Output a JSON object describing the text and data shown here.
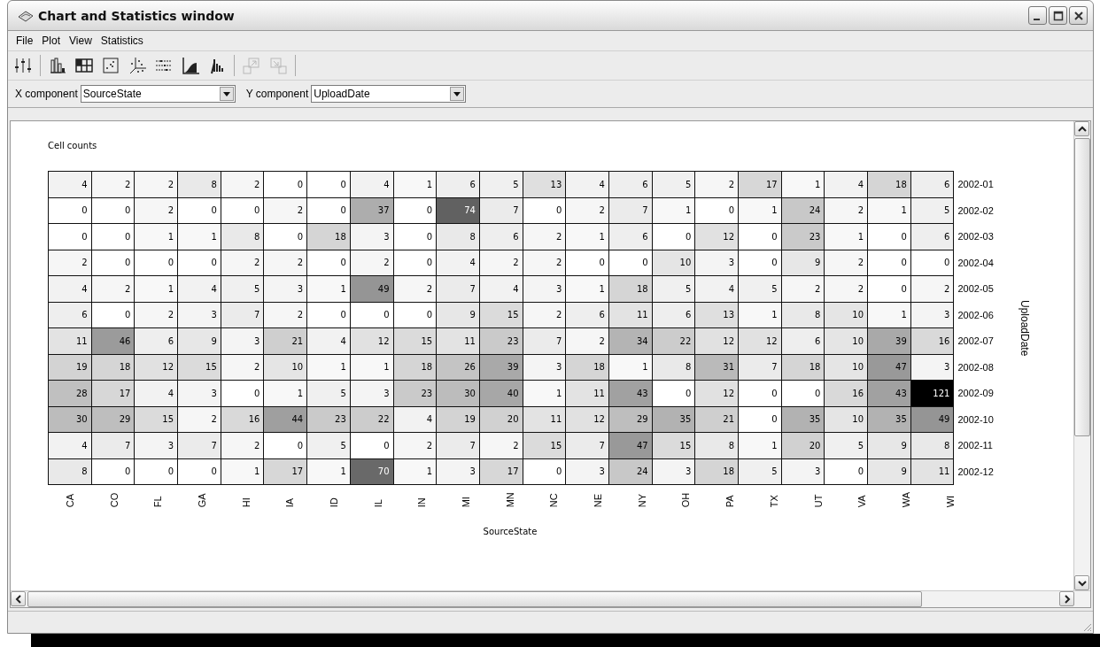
{
  "window": {
    "title": "Chart and Statistics window"
  },
  "menu": [
    "File",
    "Plot",
    "View",
    "Statistics"
  ],
  "toolbar": [
    [
      {
        "kind": "sliders",
        "disabled": false
      }
    ],
    [
      {
        "kind": "bars",
        "disabled": false
      },
      {
        "kind": "grid",
        "disabled": false
      },
      {
        "kind": "scatter",
        "disabled": false
      },
      {
        "kind": "axes3d",
        "disabled": false
      },
      {
        "kind": "strips",
        "disabled": false
      },
      {
        "kind": "area",
        "disabled": false
      },
      {
        "kind": "spikes",
        "disabled": false
      }
    ],
    [
      {
        "kind": "arrow_out",
        "disabled": true
      },
      {
        "kind": "arrow_in",
        "disabled": true
      }
    ]
  ],
  "components": [
    {
      "label": "X component",
      "value": "SourceState"
    },
    {
      "label": "Y component",
      "value": "UploadDate"
    }
  ],
  "chart": {
    "title": "Cell counts",
    "y_axis_label": "UploadDate",
    "rows": [
      {
        "label": "2002-01",
        "cells": [
          "4",
          "2",
          "2",
          "8",
          "2",
          "0",
          "0",
          "4",
          "1",
          "6",
          "5",
          "13",
          "4",
          "6",
          "5",
          "2",
          "17",
          "1",
          "4",
          "18",
          "6"
        ]
      },
      {
        "label": "2002-02",
        "cells": [
          "0",
          "0",
          "2",
          "0",
          "0",
          "2",
          "0",
          "37",
          "0",
          "74",
          "7",
          "0",
          "2",
          "7",
          "1",
          "0",
          "1",
          "24",
          "2",
          "1",
          "5"
        ]
      },
      {
        "label": "2002-03",
        "cells": [
          "0",
          "0",
          "1",
          "1",
          "8",
          "0",
          "18",
          "3",
          "0",
          "8",
          "6",
          "2",
          "1",
          "6",
          "0",
          "12",
          "0",
          "23",
          "1",
          "0",
          "6"
        ]
      },
      {
        "label": "2002-04",
        "cells": [
          "2",
          "0",
          "0",
          "0",
          "2",
          "2",
          "0",
          "2",
          "0",
          "4",
          "2",
          "2",
          "0",
          "0",
          "10",
          "3",
          "0",
          "9",
          "2",
          "0",
          "0"
        ]
      },
      {
        "label": "2002-05",
        "cells": [
          "4",
          "2",
          "1",
          "4",
          "5",
          "3",
          "1",
          "49",
          "2",
          "7",
          "4",
          "3",
          "1",
          "18",
          "5",
          "4",
          "5",
          "2",
          "2",
          "0",
          "2"
        ]
      },
      {
        "label": "2002-06",
        "cells": [
          "6",
          "0",
          "2",
          "3",
          "7",
          "2",
          "0",
          "0",
          "0",
          "9",
          "15",
          "2",
          "6",
          "11",
          "6",
          "13",
          "1",
          "8",
          "10",
          "1",
          "3"
        ]
      },
      {
        "label": "2002-07",
        "cells": [
          "11",
          "46",
          "6",
          "9",
          "3",
          "21",
          "4",
          "12",
          "15",
          "11",
          "23",
          "7",
          "2",
          "34",
          "22",
          "12",
          "12",
          "6",
          "10",
          "39",
          "16"
        ]
      },
      {
        "label": "2002-08",
        "cells": [
          "19",
          "18",
          "12",
          "15",
          "2",
          "10",
          "1",
          "1",
          "18",
          "26",
          "39",
          "3",
          "18",
          "1",
          "8",
          "31",
          "7",
          "18",
          "10",
          "47",
          "3"
        ]
      },
      {
        "label": "2002-09",
        "cells": [
          "28",
          "17",
          "4",
          "3",
          "0",
          "1",
          "5",
          "3",
          "23",
          "30",
          "40",
          "1",
          "11",
          "43",
          "0",
          "12",
          "0",
          "0",
          "16",
          "43",
          "121"
        ]
      },
      {
        "label": "2002-10",
        "cells": [
          "30",
          "29",
          "15",
          "2",
          "16",
          "44",
          "23",
          "22",
          "4",
          "19",
          "20",
          "11",
          "12",
          "29",
          "35",
          "21",
          "0",
          "35",
          "10",
          "35",
          "49"
        ]
      },
      {
        "label": "2002-11",
        "cells": [
          "4",
          "7",
          "3",
          "7",
          "2",
          "0",
          "5",
          "0",
          "2",
          "7",
          "2",
          "15",
          "7",
          "47",
          "15",
          "8",
          "1",
          "20",
          "5",
          "9",
          "8"
        ]
      },
      {
        "label": "2002-12",
        "cells": [
          "8",
          "0",
          "0",
          "0",
          "1",
          "17",
          "1",
          "70",
          "1",
          "3",
          "17",
          "0",
          "3",
          "24",
          "3",
          "18",
          "5",
          "3",
          "0",
          "9",
          "11"
        ]
      }
    ],
    "axis_labels": [
      "CA",
      "CO",
      "FL",
      "GA",
      "HI",
      "IA",
      "ID",
      "IL",
      "IN",
      "MI",
      "MN",
      "NC",
      "NE",
      "NY",
      "OH",
      "PA",
      "TX",
      "UT",
      "VA",
      "WA",
      "WI"
    ],
    "x_axis_label": "SourceState"
  }
}
